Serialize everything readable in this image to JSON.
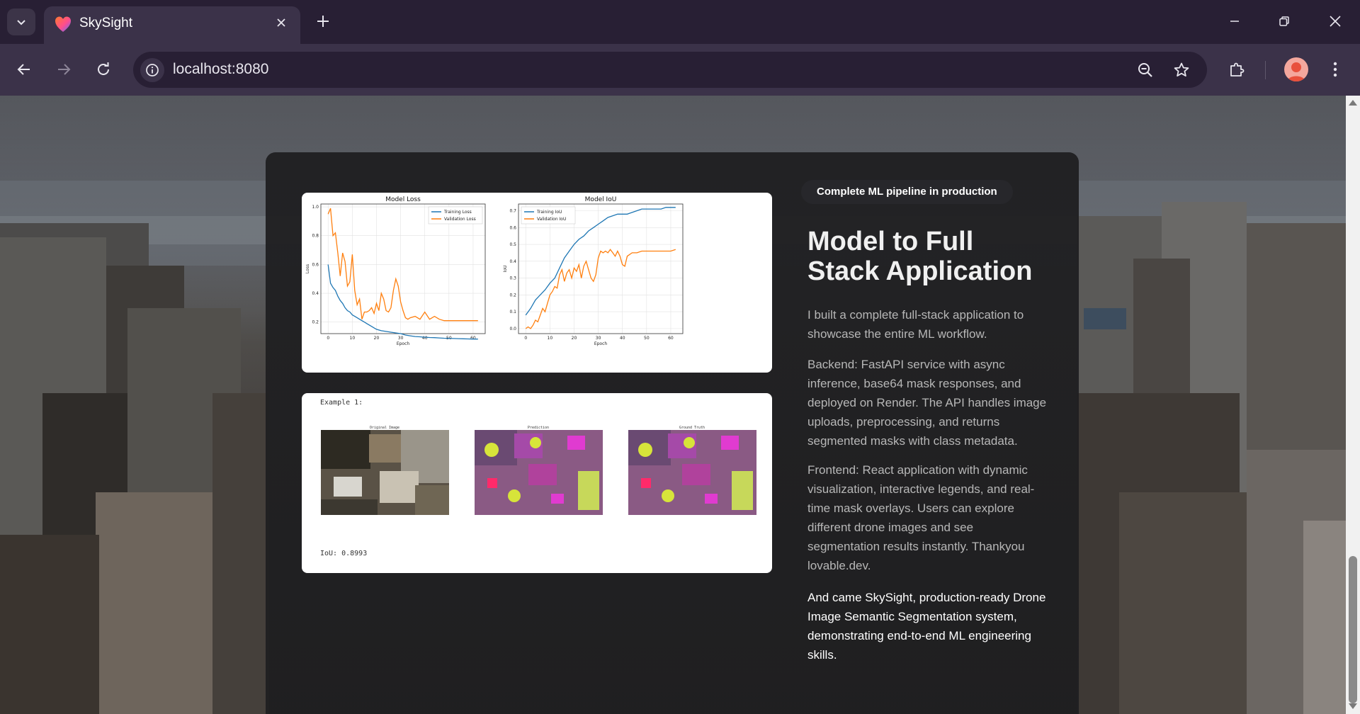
{
  "browser": {
    "tab_title": "SkySight",
    "url": "localhost:8080"
  },
  "hero": {
    "badge": "Complete ML pipeline in production",
    "title": "Model to Full Stack Application",
    "paragraphs": [
      "I built a complete full-stack application to showcase the entire ML workflow.",
      "Backend: FastAPI service with async inference, base64 mask responses, and deployed on Render. The API handles image uploads, preprocessing, and returns segmented masks with class metadata.",
      "Frontend: React application with dynamic visualization, interactive legends, and real-time mask overlays. Users can explore different drone images and see segmentation results instantly. Thankyou lovable.dev."
    ],
    "closing": "And came SkySight, production-ready Drone Image Semantic Segmentation system, demonstrating end-to-end ML engineering skills."
  },
  "example_figure": {
    "caption": "Example 1:",
    "panel_titles": [
      "Original Image",
      "Prediction",
      "Ground Truth"
    ],
    "iou_text": "IoU: 0.8993"
  },
  "chart_data": [
    {
      "type": "line",
      "title": "Model Loss",
      "xlabel": "Epoch",
      "ylabel": "Loss",
      "xlim": [
        -3,
        65
      ],
      "ylim": [
        0.12,
        1.02
      ],
      "xticks": [
        0,
        10,
        20,
        30,
        40,
        50,
        60
      ],
      "yticks": [
        0.2,
        0.4,
        0.6,
        0.8,
        1.0
      ],
      "grid": true,
      "legend": "top-right",
      "colors": [
        "#1f77b4",
        "#ff7f0e"
      ],
      "series": [
        {
          "name": "Training Loss",
          "x": [
            0,
            1,
            2,
            3,
            4,
            5,
            6,
            7,
            8,
            9,
            10,
            11,
            12,
            13,
            14,
            15,
            16,
            17,
            18,
            19,
            20,
            22,
            24,
            26,
            28,
            30,
            32,
            34,
            36,
            38,
            40,
            42,
            44,
            46,
            48,
            50,
            52,
            54,
            56,
            58,
            60,
            62
          ],
          "y": [
            0.6,
            0.47,
            0.44,
            0.42,
            0.38,
            0.35,
            0.33,
            0.3,
            0.28,
            0.27,
            0.25,
            0.24,
            0.23,
            0.22,
            0.21,
            0.2,
            0.19,
            0.18,
            0.17,
            0.16,
            0.15,
            0.14,
            0.135,
            0.13,
            0.125,
            0.12,
            0.11,
            0.105,
            0.1,
            0.098,
            0.095,
            0.093,
            0.092,
            0.09,
            0.088,
            0.087,
            0.086,
            0.085,
            0.084,
            0.083,
            0.082,
            0.082
          ]
        },
        {
          "name": "Validation Loss",
          "x": [
            0,
            1,
            2,
            3,
            4,
            5,
            6,
            7,
            8,
            9,
            10,
            11,
            12,
            13,
            14,
            15,
            16,
            17,
            18,
            19,
            20,
            21,
            22,
            23,
            24,
            25,
            26,
            27,
            28,
            29,
            30,
            31,
            32,
            33,
            34,
            36,
            38,
            40,
            42,
            44,
            46,
            48,
            50,
            52,
            54,
            56,
            58,
            60,
            62
          ],
          "y": [
            0.95,
            0.99,
            0.8,
            0.82,
            0.68,
            0.52,
            0.68,
            0.62,
            0.45,
            0.48,
            0.67,
            0.42,
            0.32,
            0.36,
            0.22,
            0.27,
            0.27,
            0.28,
            0.3,
            0.26,
            0.33,
            0.28,
            0.4,
            0.36,
            0.28,
            0.27,
            0.3,
            0.42,
            0.5,
            0.45,
            0.34,
            0.28,
            0.23,
            0.22,
            0.23,
            0.24,
            0.22,
            0.27,
            0.22,
            0.24,
            0.22,
            0.21,
            0.21,
            0.21,
            0.21,
            0.21,
            0.21,
            0.21,
            0.21
          ]
        }
      ]
    },
    {
      "type": "line",
      "title": "Model IoU",
      "xlabel": "Epoch",
      "ylabel": "IoU",
      "xlim": [
        -3,
        65
      ],
      "ylim": [
        -0.03,
        0.74
      ],
      "xticks": [
        0,
        10,
        20,
        30,
        40,
        50,
        60
      ],
      "yticks": [
        0.0,
        0.1,
        0.2,
        0.3,
        0.4,
        0.5,
        0.6,
        0.7
      ],
      "grid": true,
      "legend": "top-left",
      "colors": [
        "#1f77b4",
        "#ff7f0e"
      ],
      "series": [
        {
          "name": "Training IoU",
          "x": [
            0,
            2,
            4,
            6,
            8,
            10,
            12,
            14,
            16,
            18,
            20,
            22,
            24,
            26,
            28,
            30,
            32,
            34,
            36,
            38,
            40,
            42,
            44,
            46,
            48,
            50,
            52,
            54,
            56,
            58,
            60,
            62
          ],
          "y": [
            0.08,
            0.12,
            0.17,
            0.2,
            0.23,
            0.27,
            0.3,
            0.36,
            0.42,
            0.46,
            0.5,
            0.53,
            0.55,
            0.58,
            0.6,
            0.62,
            0.64,
            0.66,
            0.67,
            0.68,
            0.68,
            0.68,
            0.69,
            0.7,
            0.71,
            0.71,
            0.71,
            0.71,
            0.71,
            0.72,
            0.72,
            0.72
          ]
        },
        {
          "name": "Validation IoU",
          "x": [
            0,
            1,
            2,
            3,
            4,
            5,
            6,
            7,
            8,
            9,
            10,
            11,
            12,
            13,
            14,
            15,
            16,
            17,
            18,
            19,
            20,
            21,
            22,
            23,
            24,
            25,
            26,
            27,
            28,
            29,
            30,
            31,
            32,
            33,
            34,
            35,
            36,
            37,
            38,
            39,
            40,
            41,
            42,
            44,
            46,
            48,
            50,
            52,
            54,
            56,
            58,
            60,
            62
          ],
          "y": [
            0.0,
            0.01,
            0.0,
            0.02,
            0.05,
            0.04,
            0.08,
            0.12,
            0.1,
            0.15,
            0.2,
            0.22,
            0.25,
            0.24,
            0.32,
            0.35,
            0.28,
            0.33,
            0.35,
            0.3,
            0.36,
            0.34,
            0.38,
            0.3,
            0.37,
            0.4,
            0.35,
            0.3,
            0.28,
            0.32,
            0.42,
            0.46,
            0.45,
            0.46,
            0.45,
            0.47,
            0.45,
            0.43,
            0.46,
            0.43,
            0.38,
            0.37,
            0.43,
            0.45,
            0.45,
            0.46,
            0.46,
            0.46,
            0.46,
            0.46,
            0.46,
            0.46,
            0.47
          ]
        }
      ]
    }
  ]
}
